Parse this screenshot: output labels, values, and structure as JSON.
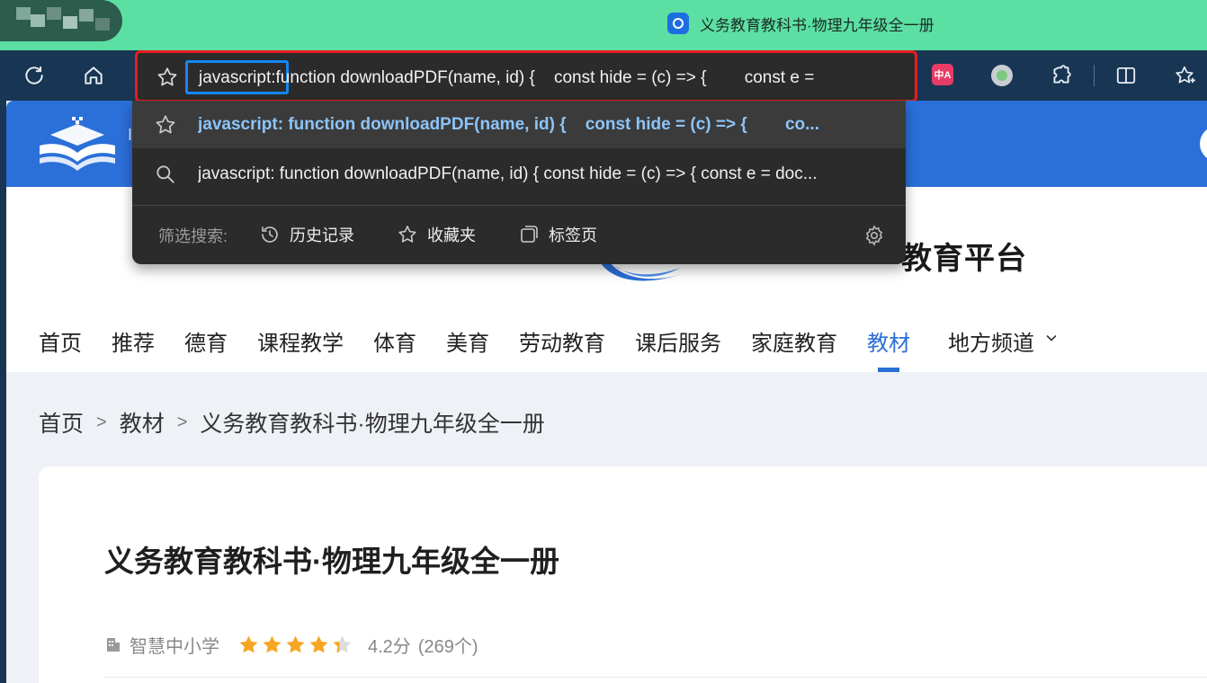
{
  "tab": {
    "title": "义务教育教科书·物理九年级全一册"
  },
  "address_bar": {
    "selected_prefix": "javascript:",
    "value": "function downloadPDF(name, id) {    const hide = (c) => {        const e ="
  },
  "suggestions": [
    {
      "type": "favorite",
      "icon": "star-icon",
      "text": "javascript: function downloadPDF(name, id) {    const hide = (c) => {        co..."
    },
    {
      "type": "search",
      "icon": "search-icon",
      "text": "javascript: function downloadPDF(name, id) { const hide = (c) => { const e = doc..."
    }
  ],
  "filter": {
    "label": "筛选搜索:",
    "buttons": [
      {
        "label": "历史记录",
        "icon": "history-icon"
      },
      {
        "label": "收藏夹",
        "icon": "star-icon"
      },
      {
        "label": "标签页",
        "icon": "tabs-icon"
      }
    ]
  },
  "site": {
    "platform_title_fragment": "教育平台",
    "banner_fragment": "I S"
  },
  "nav": {
    "items": [
      "首页",
      "推荐",
      "德育",
      "课程教学",
      "体育",
      "美育",
      "劳动教育",
      "课后服务",
      "家庭教育",
      "教材",
      "地方频道"
    ],
    "active": "教材"
  },
  "breadcrumb": {
    "items": [
      "首页",
      "教材",
      "义务教育教科书·物理九年级全一册"
    ],
    "separator": ">"
  },
  "book": {
    "title": "义务教育教科书·物理九年级全一册",
    "publisher": "智慧中小学",
    "rating": 4.2,
    "rating_text": "4.2分",
    "reviews_text": "(269个)"
  },
  "colors": {
    "title_strip": "#5cdfa3",
    "toolbar": "#183653",
    "highlight_border": "#ea1d1d",
    "selection_border": "#1587f5",
    "suggestion_highlight_text": "#8cc4f8",
    "site_blue": "#2b6fd8",
    "star": "#f6a623"
  }
}
